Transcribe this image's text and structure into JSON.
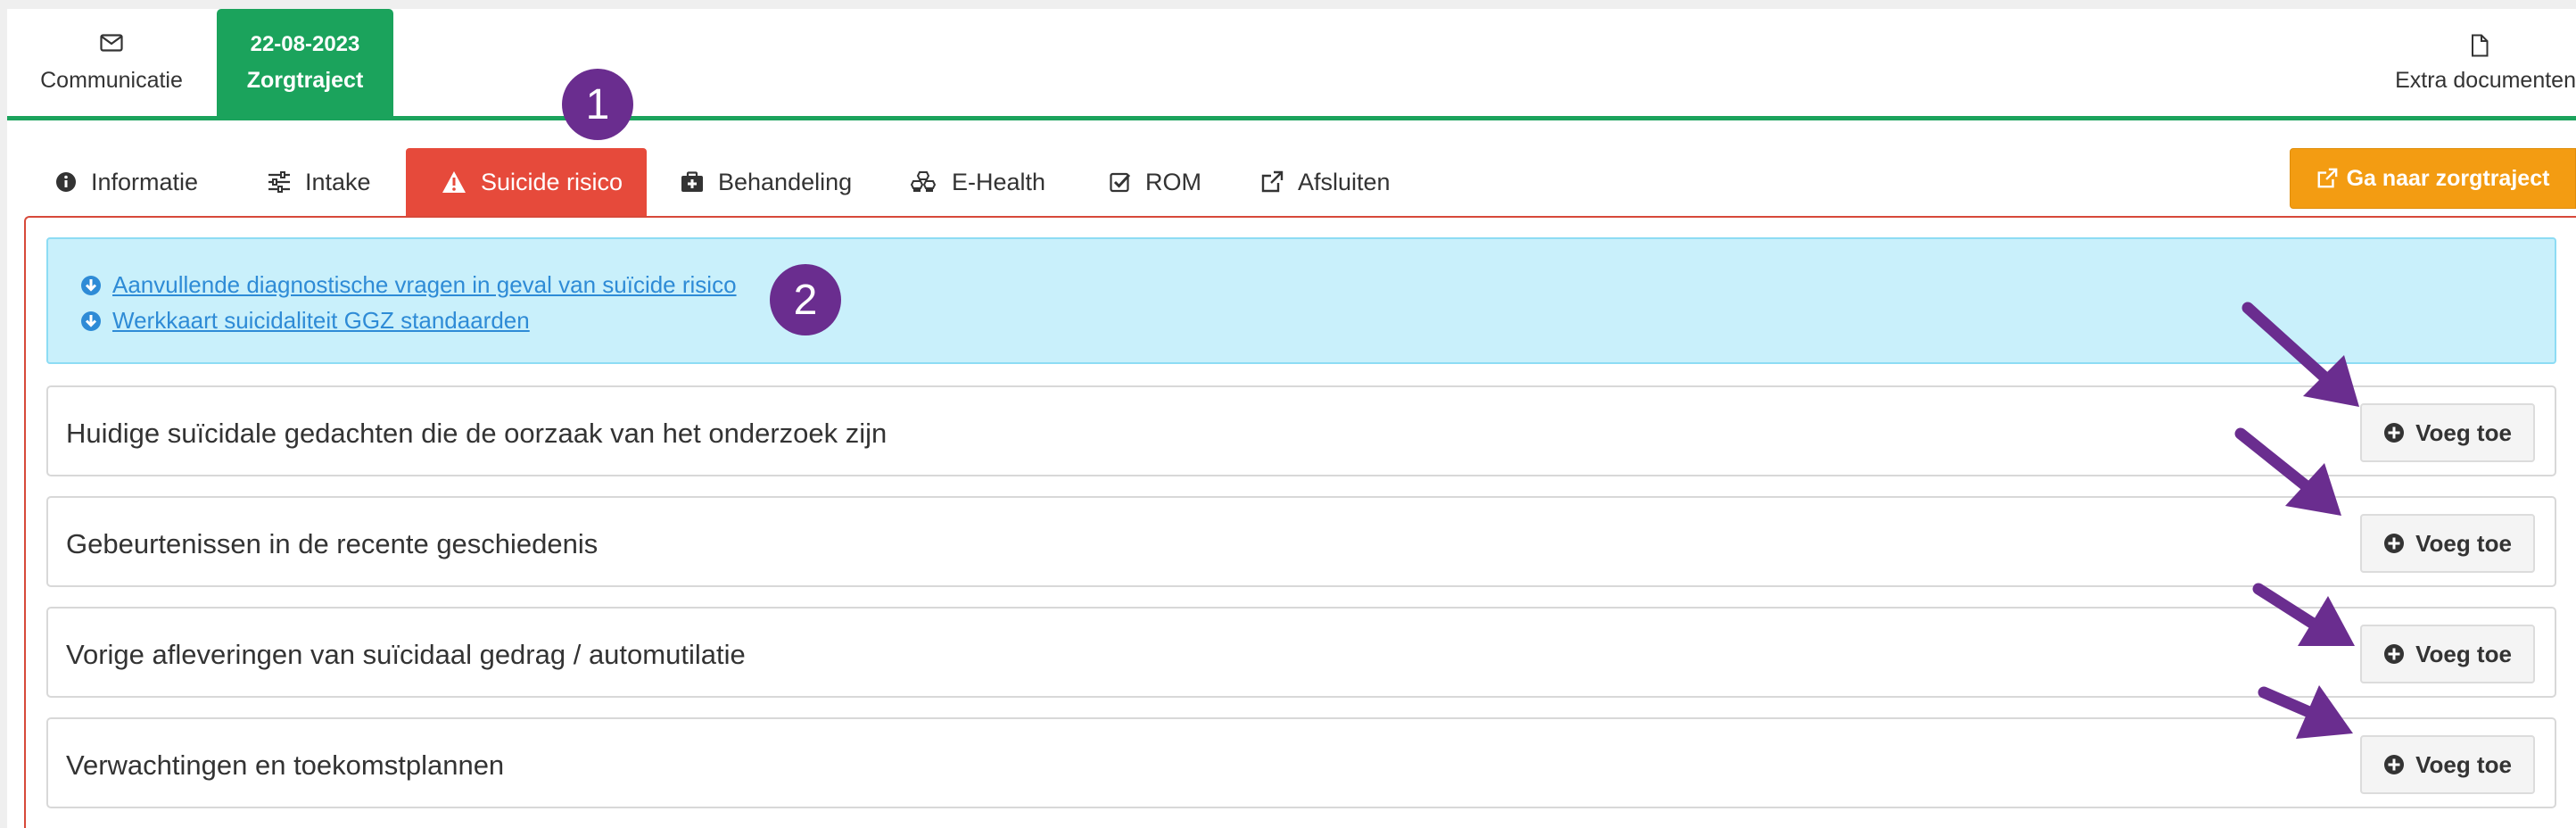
{
  "top_tabs": {
    "communicatie": {
      "label": "Communicatie",
      "icon": "envelope-icon"
    },
    "zorgtraject": {
      "date": "22-08-2023",
      "label": "Zorgtraject"
    },
    "extra_documenten": {
      "label": "Extra documenten",
      "icon": "file-icon"
    }
  },
  "sub_tabs": [
    {
      "label": "Informatie",
      "icon": "info-circle-icon"
    },
    {
      "label": "Intake",
      "icon": "sliders-icon"
    },
    {
      "label": "Suicide risico",
      "icon": "warning-icon",
      "active": true
    },
    {
      "label": "Behandeling",
      "icon": "medkit-icon"
    },
    {
      "label": "E-Health",
      "icon": "cubes-icon"
    },
    {
      "label": "ROM",
      "icon": "check-square-icon"
    },
    {
      "label": "Afsluiten",
      "icon": "external-link-icon"
    }
  ],
  "goto_button": {
    "label": "Ga naar zorgtraject"
  },
  "info_links": [
    {
      "label": "Aanvullende diagnostische vragen in geval van suïcide risico"
    },
    {
      "label": "Werkkaart suicidaliteit GGZ standaarden"
    }
  ],
  "sections": [
    {
      "title": "Huidige suïcidale gedachten die de oorzaak van het onderzoek zijn",
      "button": "Voeg toe"
    },
    {
      "title": "Gebeurtenissen in de recente geschiedenis",
      "button": "Voeg toe"
    },
    {
      "title": "Vorige afleveringen van suïcidaal gedrag / automutilatie",
      "button": "Voeg toe"
    },
    {
      "title": "Verwachtingen en toekomstplannen",
      "button": "Voeg toe"
    }
  ],
  "annotations": {
    "badge1": "1",
    "badge2": "2"
  },
  "colors": {
    "green": "#1ba35c",
    "red": "#e64a3b",
    "orange": "#f39c12",
    "info_bg": "#c9f0fb",
    "link": "#2e8bd6",
    "annotation_purple": "#6a2d8f"
  }
}
